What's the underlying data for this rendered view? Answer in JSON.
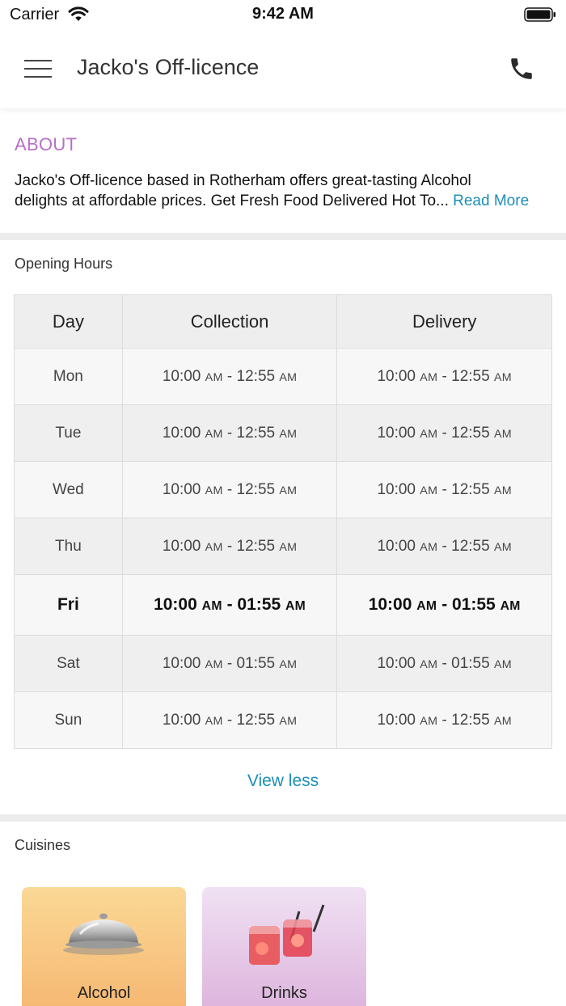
{
  "status_bar": {
    "carrier": "Carrier",
    "time": "9:42 AM"
  },
  "header": {
    "title": "Jacko's Off-licence"
  },
  "about": {
    "heading": "ABOUT",
    "line1": "Jacko's Off-licence based in Rotherham offers great-tasting Alcohol",
    "line2": "delights at affordable prices. Get Fresh Food Delivered Hot To",
    "ellipsis": "...",
    "read_more": "Read More"
  },
  "opening_hours": {
    "heading": "Opening Hours",
    "columns": [
      "Day",
      "Collection",
      "Delivery"
    ],
    "rows": [
      {
        "day": "Mon",
        "collection": {
          "open": "10:00",
          "open_ampm": "AM",
          "close": "12:55",
          "close_ampm": "AM"
        },
        "delivery": {
          "open": "10:00",
          "open_ampm": "AM",
          "close": "12:55",
          "close_ampm": "AM"
        }
      },
      {
        "day": "Tue",
        "collection": {
          "open": "10:00",
          "open_ampm": "AM",
          "close": "12:55",
          "close_ampm": "AM"
        },
        "delivery": {
          "open": "10:00",
          "open_ampm": "AM",
          "close": "12:55",
          "close_ampm": "AM"
        }
      },
      {
        "day": "Wed",
        "collection": {
          "open": "10:00",
          "open_ampm": "AM",
          "close": "12:55",
          "close_ampm": "AM"
        },
        "delivery": {
          "open": "10:00",
          "open_ampm": "AM",
          "close": "12:55",
          "close_ampm": "AM"
        }
      },
      {
        "day": "Thu",
        "collection": {
          "open": "10:00",
          "open_ampm": "AM",
          "close": "12:55",
          "close_ampm": "AM"
        },
        "delivery": {
          "open": "10:00",
          "open_ampm": "AM",
          "close": "12:55",
          "close_ampm": "AM"
        }
      },
      {
        "day": "Fri",
        "collection": {
          "open": "10:00",
          "open_ampm": "AM",
          "close": "01:55",
          "close_ampm": "AM"
        },
        "delivery": {
          "open": "10:00",
          "open_ampm": "AM",
          "close": "01:55",
          "close_ampm": "AM"
        }
      },
      {
        "day": "Sat",
        "collection": {
          "open": "10:00",
          "open_ampm": "AM",
          "close": "01:55",
          "close_ampm": "AM"
        },
        "delivery": {
          "open": "10:00",
          "open_ampm": "AM",
          "close": "01:55",
          "close_ampm": "AM"
        }
      },
      {
        "day": "Sun",
        "collection": {
          "open": "10:00",
          "open_ampm": "AM",
          "close": "12:55",
          "close_ampm": "AM"
        },
        "delivery": {
          "open": "10:00",
          "open_ampm": "AM",
          "close": "12:55",
          "close_ampm": "AM"
        }
      }
    ],
    "view_less": "View less"
  },
  "cuisines": {
    "heading": "Cuisines",
    "items": [
      {
        "label": "Alcohol",
        "icon": "cloche-icon"
      },
      {
        "label": "Drinks",
        "icon": "cocktail-glasses-icon"
      }
    ]
  },
  "colors": {
    "accent_link": "#1d8fb8",
    "about_heading": "#b86fc9"
  }
}
